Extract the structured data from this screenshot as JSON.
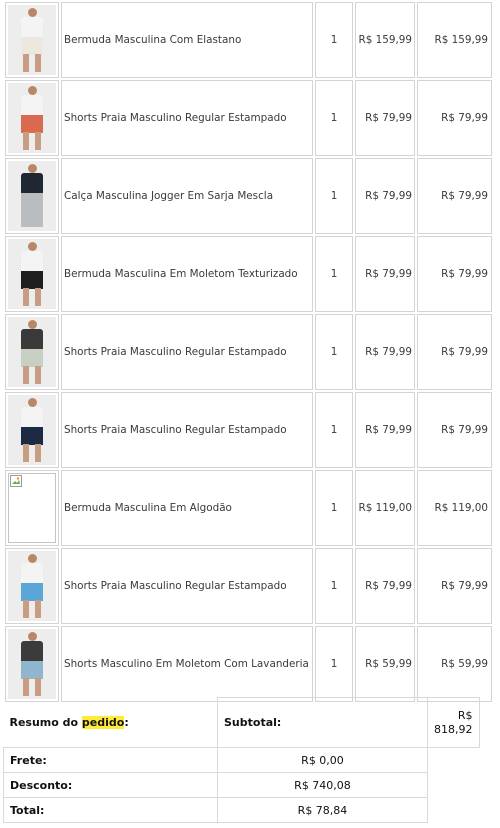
{
  "items": [
    {
      "name": "Bermuda Masculina Com Elastano",
      "qty": "1",
      "price": "R$ 159,99",
      "total": "R$ 159,99",
      "image": "product-photo",
      "colors": {
        "top": "#f4f4f4",
        "bottom": "#ece8dd"
      }
    },
    {
      "name": "Shorts Praia Masculino Regular Estampado",
      "qty": "1",
      "price": "R$ 79,99",
      "total": "R$ 79,99",
      "image": "product-photo",
      "colors": {
        "top": "#f4f4f4",
        "bottom": "#d9694f"
      }
    },
    {
      "name": "Calça Masculina Jogger Em Sarja Mescla",
      "qty": "1",
      "price": "R$ 79,99",
      "total": "R$ 79,99",
      "image": "product-photo",
      "colors": {
        "top": "#1f2733",
        "bottom": "#b9bdbf"
      }
    },
    {
      "name": "Bermuda Masculina Em Moletom Texturizado",
      "qty": "1",
      "price": "R$ 79,99",
      "total": "R$ 79,99",
      "image": "product-photo",
      "colors": {
        "top": "#f4f4f4",
        "bottom": "#1e1e1e"
      }
    },
    {
      "name": "Shorts Praia Masculino Regular Estampado",
      "qty": "1",
      "price": "R$ 79,99",
      "total": "R$ 79,99",
      "image": "product-photo",
      "colors": {
        "top": "#3a3a3a",
        "bottom": "#c8cfc3"
      }
    },
    {
      "name": "Shorts Praia Masculino Regular Estampado",
      "qty": "1",
      "price": "R$ 79,99",
      "total": "R$ 79,99",
      "image": "product-photo",
      "colors": {
        "top": "#f4f4f4",
        "bottom": "#1d2a44"
      }
    },
    {
      "name": "Bermuda Masculina Em Algodão",
      "qty": "1",
      "price": "R$ 119,00",
      "total": "R$ 119,00",
      "image": "broken-image",
      "colors": {
        "top": "#ffffff",
        "bottom": "#ffffff"
      }
    },
    {
      "name": "Shorts Praia Masculino Regular Estampado",
      "qty": "1",
      "price": "R$ 79,99",
      "total": "R$ 79,99",
      "image": "product-photo",
      "colors": {
        "top": "#f4f4f4",
        "bottom": "#5aa6d6"
      }
    },
    {
      "name": "Shorts Masculino Em Moletom Com Lavanderia",
      "qty": "1",
      "price": "R$ 59,99",
      "total": "R$ 59,99",
      "image": "product-photo",
      "colors": {
        "top": "#3b3b3b",
        "bottom": "#8fb6cf"
      }
    }
  ],
  "summary": {
    "title_prefix": "Resumo do ",
    "title_highlight": "pedido",
    "title_suffix": ":",
    "subtotal_label": "Subtotal:",
    "subtotal_value": "R$ 818,92",
    "frete_label": "Frete:",
    "frete_value": "R$ 0,00",
    "desconto_label": "Desconto:",
    "desconto_value": "R$ 740,08",
    "total_label": "Total:",
    "total_value": "R$ 78,84",
    "highlight_color": "#ffeb3b"
  }
}
